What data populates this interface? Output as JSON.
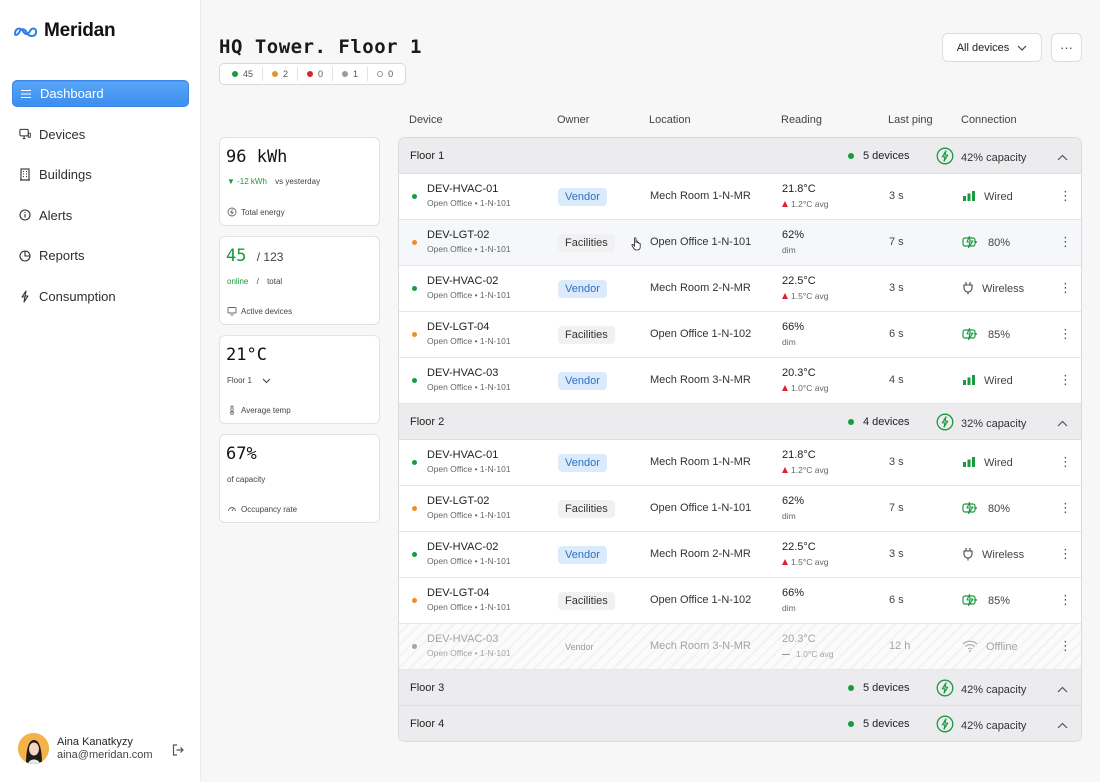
{
  "brand": {
    "name": "Meridan",
    "logo_icon": "infinity-cloud-icon",
    "accent": "#3b8ef0"
  },
  "nav": [
    {
      "label": "Dashboard",
      "icon": "list-icon",
      "active": true
    },
    {
      "label": "Devices",
      "icon": "monitor-icon",
      "active": false
    },
    {
      "label": "Buildings",
      "icon": "building-icon",
      "active": false
    },
    {
      "label": "Alerts",
      "icon": "alert-circle-icon",
      "active": false
    },
    {
      "label": "Reports",
      "icon": "pie-chart-icon",
      "active": false
    },
    {
      "label": "Consumption",
      "icon": "bolt-icon",
      "active": false
    }
  ],
  "user": {
    "name": "Aina Kanatkyzy",
    "email": "aina@meridan.com"
  },
  "page": {
    "title": "HQ Tower. Floor 1",
    "filter_label": "All devices",
    "more_label": "···"
  },
  "status_counts": [
    {
      "count": "45",
      "color": "#1a9a3f",
      "hollow": false
    },
    {
      "count": "2",
      "color": "#e8912a",
      "hollow": false
    },
    {
      "count": "0",
      "color": "#d6262d",
      "hollow": false
    },
    {
      "count": "1",
      "color": "#9a9aa0",
      "hollow": false
    },
    {
      "count": "0",
      "color": "#9a9aa0",
      "hollow": true
    }
  ],
  "stats": {
    "energy": {
      "value": "96 kWh",
      "delta": "-12 kWh",
      "delta_label": "vs yesterday",
      "label": "Total energy"
    },
    "devices": {
      "online": "45",
      "total": "/ 123",
      "online_label": "online",
      "sep": "/",
      "total_label": "total",
      "label": "Active devices"
    },
    "temp": {
      "value": "21°C",
      "scope": "Floor 1",
      "label": "Average temp"
    },
    "occupancy": {
      "value": "67%",
      "sub": "of capacity",
      "label": "Occupancy rate"
    }
  },
  "columns": [
    "Device",
    "Owner",
    "Location",
    "Reading",
    "Last ping",
    "Connection"
  ],
  "floors": [
    {
      "name": "Floor 1",
      "devices": "5 devices",
      "capacity": "42% capacity",
      "expanded": true,
      "rows": [
        {
          "id": "DEV-HVAC-01",
          "loc": "Open Office • 1-N-101",
          "status": "#1a9a3f",
          "owner": "Vendor",
          "owner_type": "vendor",
          "location": "Mech Room 1-N-MR",
          "reading": "21.8°C",
          "reading_sub": "1.2°C avg",
          "trend": "up",
          "ping": "3 s",
          "conn": "Wired",
          "conn_icon": "signal-bars-icon"
        },
        {
          "id": "DEV-LGT-02",
          "loc": "Open Office • 1-N-101",
          "status": "#e8912a",
          "owner": "Facilities",
          "owner_type": "facilities",
          "location": "Open Office 1-N-101",
          "reading": "62%",
          "reading_sub": "dim",
          "trend": "none",
          "ping": "7 s",
          "conn": "80%",
          "conn_icon": "battery-charging-icon",
          "hover": true
        },
        {
          "id": "DEV-HVAC-02",
          "loc": "Open Office • 1-N-101",
          "status": "#1a9a3f",
          "owner": "Vendor",
          "owner_type": "vendor",
          "location": "Mech Room 2-N-MR",
          "reading": "22.5°C",
          "reading_sub": "1.5°C avg",
          "trend": "up",
          "ping": "3 s",
          "conn": "Wireless",
          "conn_icon": "plug-icon"
        },
        {
          "id": "DEV-LGT-04",
          "loc": "Open Office • 1-N-101",
          "status": "#e8912a",
          "owner": "Facilities",
          "owner_type": "facilities",
          "location": "Open Office 1-N-102",
          "reading": "66%",
          "reading_sub": "dim",
          "trend": "none",
          "ping": "6 s",
          "conn": "85%",
          "conn_icon": "battery-charging-icon"
        },
        {
          "id": "DEV-HVAC-03",
          "loc": "Open Office • 1-N-101",
          "status": "#1a9a3f",
          "owner": "Vendor",
          "owner_type": "vendor",
          "location": "Mech Room 3-N-MR",
          "reading": "20.3°C",
          "reading_sub": "1.0°C avg",
          "trend": "up",
          "ping": "4 s",
          "conn": "Wired",
          "conn_icon": "signal-bars-icon"
        }
      ]
    },
    {
      "name": "Floor 2",
      "devices": "4 devices",
      "capacity": "32% capacity",
      "expanded": true,
      "rows": [
        {
          "id": "DEV-HVAC-01",
          "loc": "Open Office • 1-N-101",
          "status": "#1a9a3f",
          "owner": "Vendor",
          "owner_type": "vendor",
          "location": "Mech Room 1-N-MR",
          "reading": "21.8°C",
          "reading_sub": "1.2°C avg",
          "trend": "up",
          "ping": "3 s",
          "conn": "Wired",
          "conn_icon": "signal-bars-icon"
        },
        {
          "id": "DEV-LGT-02",
          "loc": "Open Office • 1-N-101",
          "status": "#e8912a",
          "owner": "Facilities",
          "owner_type": "facilities",
          "location": "Open Office 1-N-101",
          "reading": "62%",
          "reading_sub": "dim",
          "trend": "none",
          "ping": "7 s",
          "conn": "80%",
          "conn_icon": "battery-charging-icon"
        },
        {
          "id": "DEV-HVAC-02",
          "loc": "Open Office • 1-N-101",
          "status": "#1a9a3f",
          "owner": "Vendor",
          "owner_type": "vendor",
          "location": "Mech Room 2-N-MR",
          "reading": "22.5°C",
          "reading_sub": "1.5°C avg",
          "trend": "up",
          "ping": "3 s",
          "conn": "Wireless",
          "conn_icon": "plug-icon"
        },
        {
          "id": "DEV-LGT-04",
          "loc": "Open Office • 1-N-101",
          "status": "#e8912a",
          "owner": "Facilities",
          "owner_type": "facilities",
          "location": "Open Office 1-N-102",
          "reading": "66%",
          "reading_sub": "dim",
          "trend": "none",
          "ping": "6 s",
          "conn": "85%",
          "conn_icon": "battery-charging-icon"
        },
        {
          "id": "DEV-HVAC-03",
          "loc": "Open Office • 1-N-101",
          "status": "#a3a3a8",
          "owner": "Vendor",
          "owner_type": "plain",
          "location": "Mech Room 3-N-MR",
          "reading": "20.3°C",
          "reading_sub": "1.0°C avg",
          "trend": "flat",
          "ping": "12 h",
          "conn": "Offline",
          "conn_icon": "wifi-icon",
          "offline": true
        }
      ]
    },
    {
      "name": "Floor 3",
      "devices": "5 devices",
      "capacity": "42% capacity",
      "expanded": false,
      "rows": []
    },
    {
      "name": "Floor 4",
      "devices": "5 devices",
      "capacity": "42% capacity",
      "expanded": false,
      "rows": []
    }
  ]
}
